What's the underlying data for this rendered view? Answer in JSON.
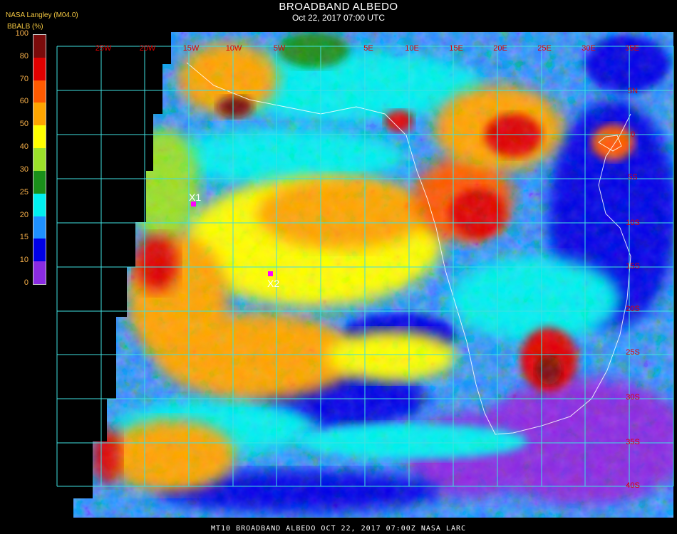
{
  "header": {
    "title": "BROADBAND ALBEDO",
    "subtitle": "Oct 22, 2017 07:00 UTC",
    "org": "NASA Langley (M04.0)"
  },
  "colorbar": {
    "title": "BBALB (%)",
    "ticks": [
      "100",
      "80",
      "70",
      "60",
      "50",
      "40",
      "30",
      "25",
      "20",
      "15",
      "10",
      "0"
    ],
    "colors": [
      "#7a0b0b",
      "#e00000",
      "#ff5a00",
      "#ffa500",
      "#ffff00",
      "#9be02a",
      "#1a8f1a",
      "#00f0f0",
      "#1e90ff",
      "#0000e6",
      "#8a2be2"
    ]
  },
  "map": {
    "longitude_labels": [
      "25W",
      "20W",
      "15W",
      "10W",
      "5W",
      "5E",
      "10E",
      "15E",
      "20E",
      "25E",
      "30E",
      "35E"
    ],
    "latitude_labels": [
      "5N",
      "0",
      "5S",
      "10S",
      "15S",
      "20S",
      "25S",
      "30S",
      "35S",
      "40S"
    ],
    "markers": [
      {
        "label": "X1",
        "color": "#ff00ff"
      },
      {
        "label": "X2",
        "color": "#ff00ff"
      }
    ],
    "grid_color": "#40e0e0",
    "label_color": "#e00000"
  },
  "footer": {
    "text": "MT10  BROADBAND ALBEDO   OCT 22, 2017 07:00Z   NASA LARC"
  }
}
